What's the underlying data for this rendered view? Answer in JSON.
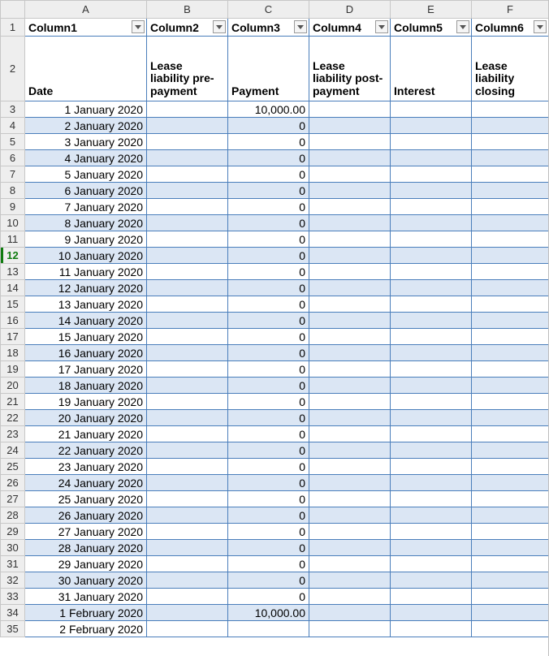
{
  "column_letters": [
    "A",
    "B",
    "C",
    "D",
    "E",
    "F"
  ],
  "filter_headers": [
    "Column1",
    "Column2",
    "Column3",
    "Column4",
    "Column5",
    "Column6"
  ],
  "sub_headers": [
    "Date",
    "Lease liability pre-payment",
    "Payment",
    "Lease liability post-payment",
    "Interest",
    "Lease liability closing"
  ],
  "selected_row_header": 12,
  "rows": [
    {
      "n": 3,
      "date": "1 January 2020",
      "payment": "10,000.00",
      "banded": false
    },
    {
      "n": 4,
      "date": "2 January 2020",
      "payment": "0",
      "banded": true
    },
    {
      "n": 5,
      "date": "3 January 2020",
      "payment": "0",
      "banded": false
    },
    {
      "n": 6,
      "date": "4 January 2020",
      "payment": "0",
      "banded": true
    },
    {
      "n": 7,
      "date": "5 January 2020",
      "payment": "0",
      "banded": false
    },
    {
      "n": 8,
      "date": "6 January 2020",
      "payment": "0",
      "banded": true
    },
    {
      "n": 9,
      "date": "7 January 2020",
      "payment": "0",
      "banded": false
    },
    {
      "n": 10,
      "date": "8 January 2020",
      "payment": "0",
      "banded": true
    },
    {
      "n": 11,
      "date": "9 January 2020",
      "payment": "0",
      "banded": false
    },
    {
      "n": 12,
      "date": "10 January 2020",
      "payment": "0",
      "banded": true
    },
    {
      "n": 13,
      "date": "11 January 2020",
      "payment": "0",
      "banded": false
    },
    {
      "n": 14,
      "date": "12 January 2020",
      "payment": "0",
      "banded": true
    },
    {
      "n": 15,
      "date": "13 January 2020",
      "payment": "0",
      "banded": false
    },
    {
      "n": 16,
      "date": "14 January 2020",
      "payment": "0",
      "banded": true
    },
    {
      "n": 17,
      "date": "15 January 2020",
      "payment": "0",
      "banded": false
    },
    {
      "n": 18,
      "date": "16 January 2020",
      "payment": "0",
      "banded": true
    },
    {
      "n": 19,
      "date": "17 January 2020",
      "payment": "0",
      "banded": false
    },
    {
      "n": 20,
      "date": "18 January 2020",
      "payment": "0",
      "banded": true
    },
    {
      "n": 21,
      "date": "19 January 2020",
      "payment": "0",
      "banded": false
    },
    {
      "n": 22,
      "date": "20 January 2020",
      "payment": "0",
      "banded": true
    },
    {
      "n": 23,
      "date": "21 January 2020",
      "payment": "0",
      "banded": false
    },
    {
      "n": 24,
      "date": "22 January 2020",
      "payment": "0",
      "banded": true
    },
    {
      "n": 25,
      "date": "23 January 2020",
      "payment": "0",
      "banded": false
    },
    {
      "n": 26,
      "date": "24 January 2020",
      "payment": "0",
      "banded": true
    },
    {
      "n": 27,
      "date": "25 January 2020",
      "payment": "0",
      "banded": false
    },
    {
      "n": 28,
      "date": "26 January 2020",
      "payment": "0",
      "banded": true
    },
    {
      "n": 29,
      "date": "27 January 2020",
      "payment": "0",
      "banded": false
    },
    {
      "n": 30,
      "date": "28 January 2020",
      "payment": "0",
      "banded": true
    },
    {
      "n": 31,
      "date": "29 January 2020",
      "payment": "0",
      "banded": false
    },
    {
      "n": 32,
      "date": "30 January 2020",
      "payment": "0",
      "banded": true
    },
    {
      "n": 33,
      "date": "31 January 2020",
      "payment": "0",
      "banded": false
    },
    {
      "n": 34,
      "date": "1 February 2020",
      "payment": "10,000.00",
      "banded": true
    },
    {
      "n": 35,
      "date": "2 February 2020",
      "payment": "",
      "banded": false
    }
  ]
}
